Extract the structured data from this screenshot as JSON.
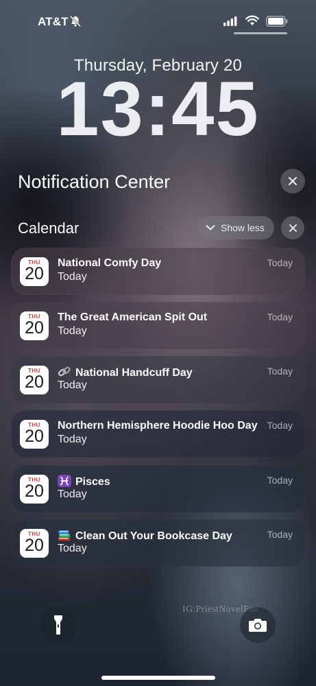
{
  "status_bar": {
    "carrier": "AT&T",
    "icons": [
      "bell-slash-icon",
      "cellular-signal-icon",
      "wifi-icon",
      "battery-icon"
    ]
  },
  "lock_screen": {
    "date": "Thursday, February 20",
    "time": "13:45"
  },
  "notification_center": {
    "title": "Notification Center",
    "close_icon": "close-icon"
  },
  "group": {
    "app": "Calendar",
    "show_less_label": "Show less",
    "chevron_icon": "chevron-down-icon",
    "close_icon": "close-icon"
  },
  "notifications": [
    {
      "app_icon_day": "THU",
      "app_icon_date": "20",
      "emoji": "",
      "title": "National Comfy Day",
      "body": "Today",
      "time": "Today"
    },
    {
      "app_icon_day": "THU",
      "app_icon_date": "20",
      "emoji": "",
      "title": "The Great American Spit Out",
      "body": "Today",
      "time": "Today"
    },
    {
      "app_icon_day": "THU",
      "app_icon_date": "20",
      "emoji": "link-icon",
      "title": "National Handcuff Day",
      "body": "Today",
      "time": "Today"
    },
    {
      "app_icon_day": "THU",
      "app_icon_date": "20",
      "emoji": "",
      "title": "Northern Hemisphere Hoodie Hoo Day",
      "body": "Today",
      "time": "Today"
    },
    {
      "app_icon_day": "THU",
      "app_icon_date": "20",
      "emoji": "pisces-icon",
      "title": "Pisces",
      "body": "Today",
      "time": "Today"
    },
    {
      "app_icon_day": "THU",
      "app_icon_date": "20",
      "emoji": "books-icon",
      "title": "Clean Out Your Bookcase Day",
      "body": "Today",
      "time": "Today"
    }
  ],
  "bottom_controls": {
    "left": "flashlight-icon",
    "right": "camera-icon"
  },
  "wallpaper": {
    "watermark": "IG:PriestNovelFan"
  },
  "colors": {
    "calendar_red": "#e53935",
    "pisces_purple": "#7b3fb6"
  }
}
